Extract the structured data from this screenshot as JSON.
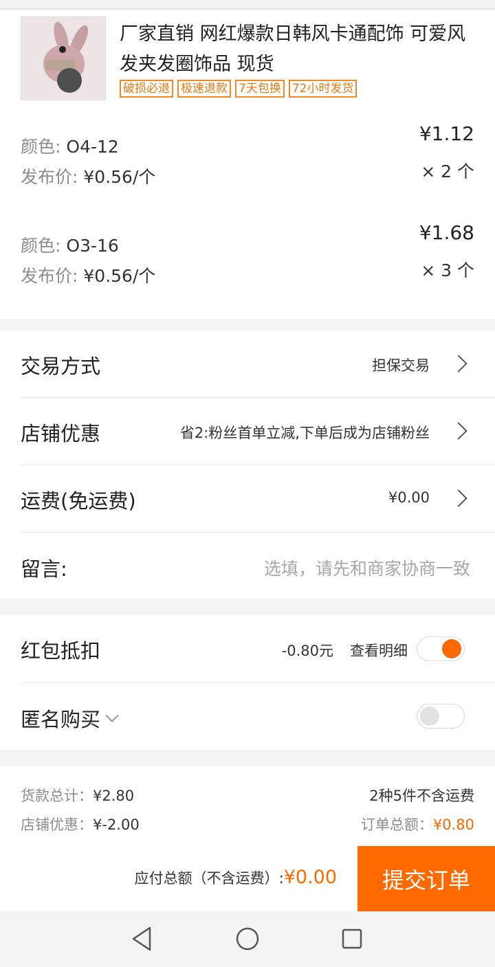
{
  "product": {
    "title": "厂家直销 网红爆款日韩风卡通配饰 可爱风发夹发圈饰品 现货",
    "badges": [
      "破损必退",
      "极速退款",
      "7天包换",
      "72小时发货"
    ],
    "variants": [
      {
        "color_label": "颜色:",
        "color": "O4-12",
        "price_label": "发布价:",
        "unit_price": "¥0.56/个",
        "subtotal": "¥1.12",
        "qty": "× 2 个"
      },
      {
        "color_label": "颜色:",
        "color": "O3-16",
        "price_label": "发布价:",
        "unit_price": "¥0.56/个",
        "subtotal": "¥1.68",
        "qty": "× 3 个"
      }
    ]
  },
  "options": {
    "trade": {
      "label": "交易方式",
      "value": "担保交易"
    },
    "shop_discount": {
      "label": "店铺优惠",
      "value": "省2:粉丝首单立减,下单后成为店铺粉丝"
    },
    "shipping": {
      "label": "运费(免运费)",
      "value": "¥0.00"
    },
    "message": {
      "label": "留言:",
      "placeholder": "选填，请先和商家协商一致"
    }
  },
  "redpacket": {
    "label": "红包抵扣",
    "amount": "-0.80元",
    "detail": "查看明细",
    "enabled": true
  },
  "anonymous": {
    "label": "匿名购买",
    "enabled": false
  },
  "summary": {
    "goods_label": "货款总计：",
    "goods_value": "¥2.80",
    "count_text": "2种5件不含运费",
    "shop_label": "店铺优惠：",
    "shop_value": "¥-2.00",
    "order_label": "订单总额：",
    "order_value": "¥0.80"
  },
  "footer": {
    "payable_label": "应付总额（不含运费）:",
    "payable_value": "¥0.00",
    "submit": "提交订单"
  },
  "colors": {
    "accent": "#ff6a00",
    "badge": "#f08a24"
  }
}
